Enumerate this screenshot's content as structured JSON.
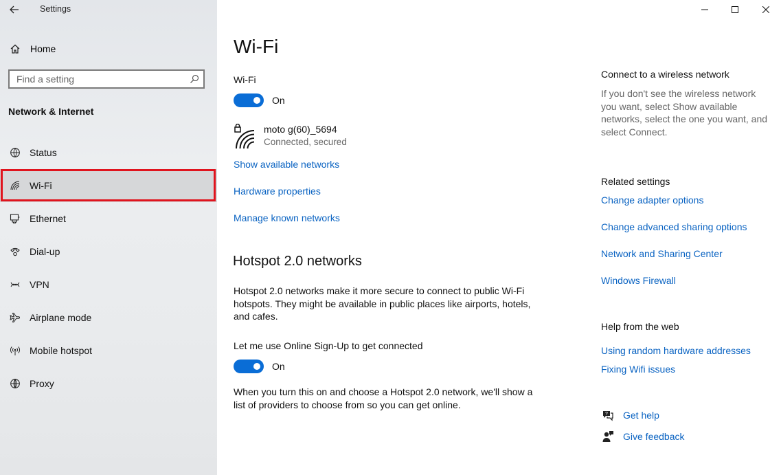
{
  "window": {
    "title": "Settings"
  },
  "sidebar": {
    "home_label": "Home",
    "search_placeholder": "Find a setting",
    "section_title": "Network & Internet",
    "items": [
      {
        "label": "Status",
        "icon": "globe-status-icon"
      },
      {
        "label": "Wi-Fi",
        "icon": "wifi-icon",
        "selected": true
      },
      {
        "label": "Ethernet",
        "icon": "ethernet-icon"
      },
      {
        "label": "Dial-up",
        "icon": "dialup-icon"
      },
      {
        "label": "VPN",
        "icon": "vpn-icon"
      },
      {
        "label": "Airplane mode",
        "icon": "airplane-icon"
      },
      {
        "label": "Mobile hotspot",
        "icon": "hotspot-icon"
      },
      {
        "label": "Proxy",
        "icon": "globe-icon"
      }
    ]
  },
  "main": {
    "title": "Wi-Fi",
    "wifi_label": "Wi-Fi",
    "wifi_state": "On",
    "network": {
      "name": "moto g(60)_5694",
      "status": "Connected, secured"
    },
    "links": {
      "show_networks": "Show available networks",
      "hardware_properties": "Hardware properties",
      "manage_networks": "Manage known networks"
    },
    "hotspot": {
      "title": "Hotspot 2.0 networks",
      "description": "Hotspot 2.0 networks make it more secure to connect to public Wi-Fi hotspots. They might be available in public places like airports, hotels, and cafes.",
      "signup_label": "Let me use Online Sign-Up to get connected",
      "signup_state": "On",
      "footer": "When you turn this on and choose a Hotspot 2.0 network, we'll show a list of providers to choose from so you can get online."
    }
  },
  "right": {
    "connect_head": "Connect to a wireless network",
    "connect_desc": "If you don't see the wireless network you want, select Show available networks, select the one you want, and select Connect.",
    "related_head": "Related settings",
    "related_links": [
      "Change adapter options",
      "Change advanced sharing options",
      "Network and Sharing Center",
      "Windows Firewall"
    ],
    "web_head": "Help from the web",
    "web_links": [
      "Using random hardware addresses",
      "Fixing Wifi issues"
    ],
    "get_help": "Get help",
    "give_feedback": "Give feedback"
  },
  "colors": {
    "accent": "#0a6dd6",
    "link": "#0a63c2",
    "highlight": "#e0141e"
  }
}
